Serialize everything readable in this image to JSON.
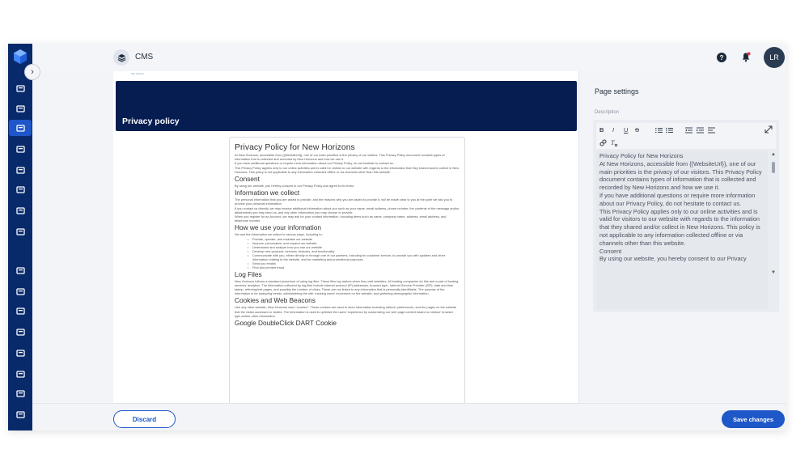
{
  "header": {
    "app_title": "CMS",
    "avatar_initials": "LR"
  },
  "rail": {
    "icons": [
      "dashboard-icon",
      "inbox-icon",
      "layers-icon",
      "payments-icon",
      "calendar-icon",
      "archive-icon",
      "table-icon",
      "location-icon",
      "grid-icon",
      "car-icon",
      "flag-icon",
      "car-front-icon",
      "tools-icon",
      "vehicle-icon",
      "truck-icon",
      "users-icon"
    ],
    "active_index": 2
  },
  "canvas": {
    "tiny_label": "Site Section",
    "hero_title": "Privacy policy",
    "doc": {
      "title": "Privacy Policy for New Horizons",
      "intro": [
        "At New Horizons, accessible from {{WebsiteUrl}}, one of our main priorities is the privacy of our visitors. This Privacy Policy document contains types of information that is collected and recorded by New Horizons and how we use it.",
        "If you have additional questions or require more information about our Privacy Policy, do not hesitate to contact us.",
        "This Privacy Policy applies only to our online activities and is valid for visitors to our website with regards to the information that they shared and/or collect in New Horizons. This policy is not applicable to any information collected offline or via channels other than this website."
      ],
      "consent_heading": "Consent",
      "consent_text": "By using our website, you hereby consent to our Privacy Policy and agree to its terms.",
      "info_heading": "Information we collect",
      "info_text": [
        "The personal information that you are asked to provide, and the reasons why you are asked to provide it, will be made clear to you at the point we ask you to provide your personal information.",
        "If you contact us directly, we may receive additional information about you such as your name, email address, phone number, the contents of the message and/or attachments you may send us, and any other information you may choose to provide.",
        "When you register for an Account, we may ask for your contact information, including items such as name, company name, address, email address, and telephone number."
      ],
      "use_heading": "How we use your information",
      "use_intro": "We use the information we collect in various ways, including to:",
      "use_list": [
        "Provide, operate, and maintain our website",
        "Improve, personalize, and expand our website",
        "Understand and analyze how you use our website",
        "Develop new products, services, features, and functionality",
        "Communicate with you, either directly or through one of our partners, including for customer service, to provide you with updates and other information relating to the website, and for marketing and promotional purposes",
        "Send you emails",
        "Find and prevent fraud"
      ],
      "log_heading": "Log Files",
      "log_text": "New Horizons follows a standard procedure of using log files. These files log visitors when they visit websites. All hosting companies do this and a part of hosting services' analytics. The information collected by log files include internet protocol (IP) addresses, browser type, Internet Service Provider (ISP), date and time stamp, referring/exit pages, and possibly the number of clicks. These are not linked to any information that is personally identifiable. The purpose of the information is for analyzing trends, administering the site, tracking users' movement on the website, and gathering demographic information.",
      "cookies_heading": "Cookies and Web Beacons",
      "cookies_text": "Like any other website, New Horizons uses \"cookies\". These cookies are used to store information including visitors' preferences, and the pages on the website that the visitor accessed or visited. The information is used to optimize the users' experience by customizing our web page content based on visitors' browser type and/or other information.",
      "google_heading": "Google DoubleClick DART Cookie"
    }
  },
  "settings": {
    "title": "Page settings",
    "description_label": "Description",
    "toolbar": [
      "B",
      "I",
      "U",
      "S"
    ],
    "editor_lines": [
      "Privacy Policy for New Horizons",
      "At New Horizons, accessible from {{WebsiteUrl}}, one of our main priorities is the privacy of our visitors. This Privacy Policy document contains types of information that is collected and recorded by New Horizons and how we use it.",
      "If you have additional questions or require more information about our Privacy Policy, do not hesitate to contact us.",
      "This Privacy Policy applies only to our online activities and is valid for visitors to our website with regards to the information that they shared and/or collect in New Horizons. This policy is not applicable to any information collected offline or via channels other than this website.",
      "Consent",
      "By using our website, you hereby consent to our Privacy"
    ]
  },
  "footer": {
    "discard_label": "Discard",
    "save_label": "Save changes"
  }
}
